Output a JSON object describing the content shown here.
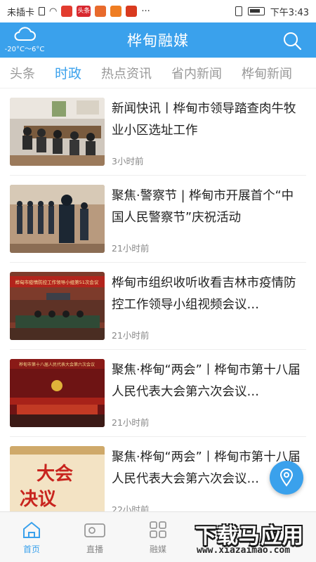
{
  "status_bar": {
    "carrier": "未插卡",
    "badge_text": "头条",
    "more": "···",
    "time": "下午3:43"
  },
  "header": {
    "title": "桦甸融媒",
    "weather_temp": "-20°C～6°C",
    "accent": "#3aa1ec"
  },
  "tabs": [
    {
      "label": "头条",
      "active": false
    },
    {
      "label": "时政",
      "active": true
    },
    {
      "label": "热点资讯",
      "active": false
    },
    {
      "label": "省内新闻",
      "active": false
    },
    {
      "label": "桦甸新闻",
      "active": false
    }
  ],
  "news": [
    {
      "title": "新闻快讯丨桦甸市领导踏查肉牛牧业小区选址工作",
      "time": "3小时前",
      "thumb": "meeting-room-photo"
    },
    {
      "title": "聚焦·警察节 | 桦甸市开展首个“中国人民警察节”庆祝活动",
      "time": "21小时前",
      "thumb": "police-salute-photo"
    },
    {
      "title": "桦甸市组织收听收看吉林市疫情防控工作领导小组视频会议…",
      "time": "21小时前",
      "thumb": "video-conference-photo"
    },
    {
      "title": "聚焦·桦甸“两会”丨桦甸市第十八届人民代表大会第六次会议…",
      "time": "21小时前",
      "thumb": "congress-hall-photo"
    },
    {
      "title": "聚焦·桦甸“两会”丨桦甸市第十八届人民代表大会第六次会议…",
      "time": "22小时前",
      "thumb": "resolution-poster"
    }
  ],
  "thumb_text": {
    "banner_3": "桦甸市疫情防控工作领导小组第51次会议",
    "banner_4": "桦甸市第十八届人民代表大会第六次会议",
    "poster_line1": "大会",
    "poster_line2": "决议"
  },
  "bottom_nav": [
    {
      "label": "首页",
      "icon": "home-icon",
      "active": true
    },
    {
      "label": "直播",
      "icon": "video-camera-icon",
      "active": false
    },
    {
      "label": "融媒",
      "icon": "grid-icon",
      "active": false
    }
  ],
  "watermark": {
    "big": "下载马应用",
    "small": "www.xiazaimao.com"
  }
}
